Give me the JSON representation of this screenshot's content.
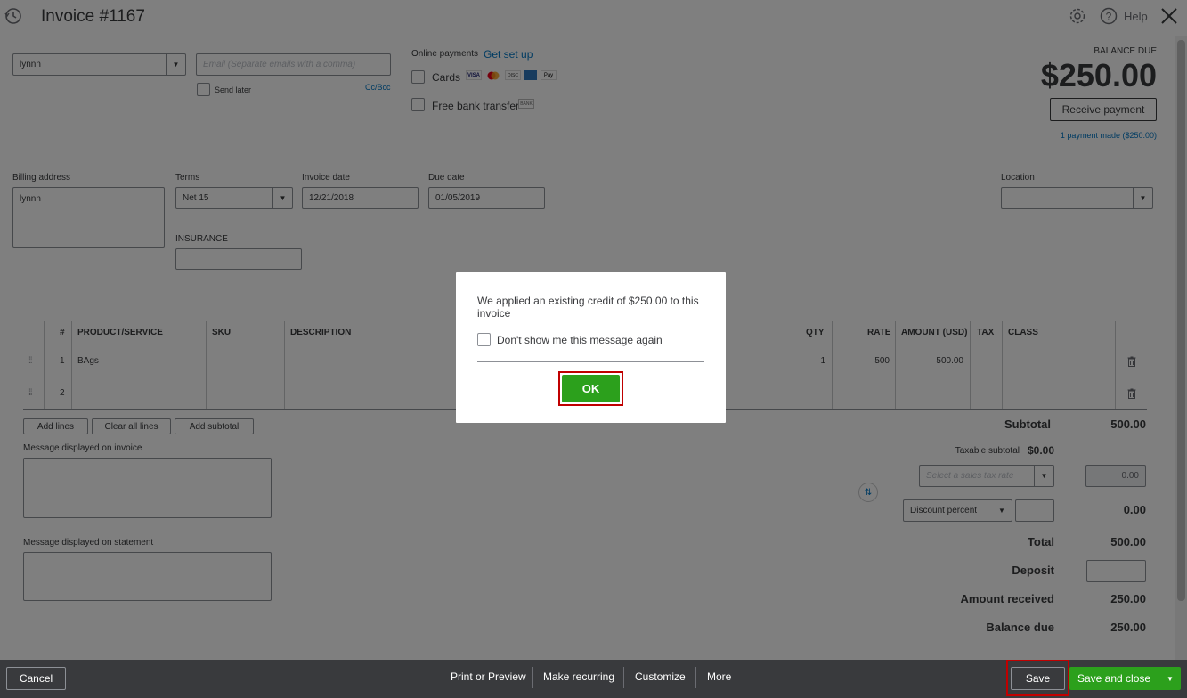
{
  "header": {
    "title": "Invoice #1167",
    "help_label": "Help",
    "icons": [
      "recent-history-icon",
      "gear-icon",
      "help-icon",
      "close-icon"
    ]
  },
  "customer": {
    "name": "lynnn",
    "email_placeholder": "Email (Separate emails with a comma)",
    "send_later_label": "Send later",
    "cc_bcc_label": "Cc/Bcc"
  },
  "online_payments": {
    "label": "Online payments",
    "setup_link": "Get set up",
    "cards_label": "Cards",
    "bank_label": "Free bank transfer",
    "bank_badge": "BANK"
  },
  "balance": {
    "label": "BALANCE DUE",
    "amount": "$250.00",
    "receive_button": "Receive payment",
    "payments_made": "1 payment made ($250.00)"
  },
  "form": {
    "billing_label": "Billing address",
    "billing_value": "lynnn",
    "terms_label": "Terms",
    "terms_value": "Net 15",
    "invoice_date_label": "Invoice date",
    "invoice_date_value": "12/21/2018",
    "due_date_label": "Due date",
    "due_date_value": "01/05/2019",
    "location_label": "Location",
    "insurance_label": "INSURANCE"
  },
  "table": {
    "headers": {
      "num": "#",
      "product": "PRODUCT/SERVICE",
      "sku": "SKU",
      "description": "DESCRIPTION",
      "qty": "QTY",
      "rate": "RATE",
      "amount": "AMOUNT (USD)",
      "tax": "TAX",
      "class": "CLASS"
    },
    "rows": [
      {
        "num": "1",
        "product": "BAgs",
        "qty": "1",
        "rate": "500",
        "amount": "500.00"
      },
      {
        "num": "2",
        "product": "",
        "qty": "",
        "rate": "",
        "amount": ""
      }
    ],
    "add_lines": "Add lines",
    "clear_lines": "Clear all lines",
    "add_subtotal": "Add subtotal"
  },
  "messages": {
    "invoice_label": "Message displayed on invoice",
    "statement_label": "Message displayed on statement"
  },
  "totals": {
    "subtotal_label": "Subtotal",
    "subtotal_value": "500.00",
    "taxable_label": "Taxable subtotal",
    "taxable_value": "$0.00",
    "tax_rate_placeholder": "Select a sales tax rate",
    "tax_value": "0.00",
    "discount_select": "Discount percent",
    "discount_value": "0.00",
    "total_label": "Total",
    "total_value": "500.00",
    "deposit_label": "Deposit",
    "amount_received_label": "Amount received",
    "amount_received_value": "250.00",
    "balance_due_label": "Balance due",
    "balance_due_value": "250.00"
  },
  "footer": {
    "cancel": "Cancel",
    "print_preview": "Print or Preview",
    "make_recurring": "Make recurring",
    "customize": "Customize",
    "more": "More",
    "save": "Save",
    "save_close": "Save and close"
  },
  "modal": {
    "message": "We applied an existing credit of $250.00 to this invoice",
    "checkbox_label": "Don't show me this message again",
    "ok": "OK"
  },
  "colors": {
    "accent_green": "#2ca01c",
    "link_blue": "#0077c5",
    "highlight_red": "#c00000",
    "footer_bg": "#393a3d"
  }
}
